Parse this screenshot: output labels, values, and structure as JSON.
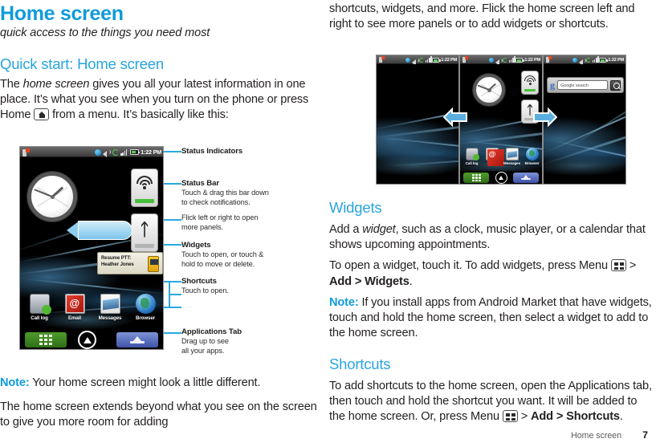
{
  "colors": {
    "accent": "#0f9bdb",
    "heading_blue": "#28a4dd",
    "body": "#231f20",
    "callout_line": "#29a8e0"
  },
  "header": {
    "title": "Home screen",
    "subtitle": "quick access to the things you need most"
  },
  "left_column": {
    "section_heading": "Quick start: Home screen",
    "intro_parts": {
      "p1a": "The ",
      "p1_italic": "home screen",
      "p1b": " gives you all your latest information in one place. It’s what you see when you turn on the phone or press Home ",
      "p1c": " from a menu. It’s basically like this:"
    },
    "note": {
      "label": "Note:",
      "text": " Your home screen might look a little different."
    },
    "paragraph": "The home screen extends beyond what you see on the screen to give you more room for adding"
  },
  "phone_figure": {
    "status_bar": {
      "time": "1:22 PM"
    },
    "widget": {
      "line1": "Resume PTT:",
      "line2": "Heather Jones"
    },
    "shortcuts": [
      {
        "label": "Call log",
        "icon": "call-log-icon"
      },
      {
        "label": "Email",
        "icon": "email-icon"
      },
      {
        "label": "Messages",
        "icon": "messages-icon"
      },
      {
        "label": "Browser",
        "icon": "browser-icon"
      }
    ],
    "callouts": [
      {
        "heading": "Status Indicators",
        "lines": []
      },
      {
        "heading": "Status Bar",
        "lines": [
          "Touch & drag this bar down",
          "to check notifications."
        ],
        "extra": [
          "Flick left or right to open",
          "more panels."
        ]
      },
      {
        "heading": "Widgets",
        "lines": [
          "Touch to open, or touch &",
          "hold to move or delete."
        ]
      },
      {
        "heading": "Shortcuts",
        "lines": [
          "Touch to open."
        ]
      },
      {
        "heading": "Applications Tab",
        "lines": [
          "Drag up to see",
          "all your apps."
        ]
      }
    ]
  },
  "panels_figure": {
    "status_time": "1:22 PM",
    "search": {
      "placeholder": "Google search",
      "logo": "g"
    },
    "shortcuts": [
      {
        "label": "Call log"
      },
      {
        "label": "Email"
      },
      {
        "label": "Messages"
      },
      {
        "label": "Browser"
      }
    ]
  },
  "right_column": {
    "continued": "shortcuts, widgets, and more. Flick the home screen left and right to see more panels or to add widgets or shortcuts.",
    "widgets": {
      "heading": "Widgets",
      "p1a": "Add a ",
      "p1_italic": "widget",
      "p1b": ", such as a clock, music player, or a calendar that shows upcoming appointments.",
      "p2a": "To open a widget, touch it. To add widgets, press Menu ",
      "p2b": " > ",
      "p2_bold": "Add > Widgets",
      "p2c": ".",
      "note_label": "Note:",
      "note_text": " If you install apps from Android Market that have widgets, touch and hold the home screen, then select a widget to add to the home screen."
    },
    "shortcuts": {
      "heading": "Shortcuts",
      "p1a": "To add shortcuts to the home screen, open the Applications tab, then touch and hold the shortcut you want. It will be added to the home screen. Or, press Menu ",
      "p1b": " > ",
      "p1_bold": "Add > Shortcuts",
      "p1c": "."
    }
  },
  "footer": {
    "label": "Home screen",
    "page": "7"
  }
}
